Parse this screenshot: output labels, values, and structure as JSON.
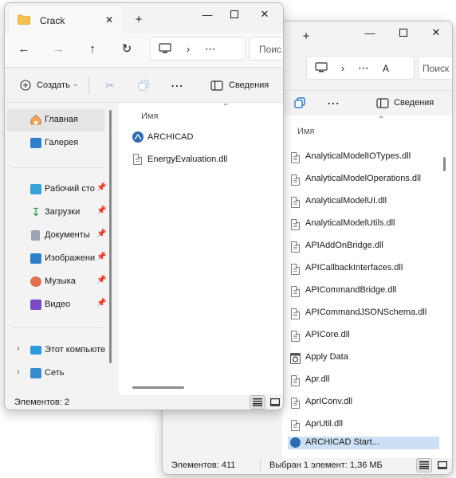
{
  "back_window": {
    "search_placeholder": "Поиск",
    "breadcrumb_more": "⋯",
    "breadcrumb_partial": "A",
    "toolbar": {
      "details_label": "Сведения",
      "more_label": "⋯"
    },
    "column_name": "Имя",
    "files": [
      "AnalyticalModelIOTypes.dll",
      "AnalyticalModelOperations.dll",
      "AnalyticalModelUI.dll",
      "AnalyticalModelUtils.dll",
      "APIAddOnBridge.dll",
      "APICallbackInterfaces.dll",
      "APICommandBridge.dll",
      "APICommandJSONSchema.dll",
      "APICore.dll",
      "Apply Data",
      "Apr.dll",
      "AprIConv.dll",
      "AprUtil.dll",
      "ARCHICAD Start..."
    ],
    "status": {
      "count": "Элементов: 411",
      "selection": "Выбран 1 элемент: 1,36 МБ"
    }
  },
  "front_window": {
    "tab_title": "Crack",
    "new_tab": "+",
    "close_tab": "✕",
    "toolbar": {
      "create_label": "Создать",
      "more_label": "⋯",
      "details_label": "Сведения"
    },
    "breadcrumb_more": "⋯",
    "search_placeholder": "Поис",
    "nav": {
      "home": "Главная",
      "gallery": "Галерея",
      "pinned": [
        "Рабочий сто",
        "Загрузки",
        "Документы",
        "Изображени",
        "Музыка",
        "Видео"
      ],
      "this_pc": "Этот компьюте",
      "network": "Сеть"
    },
    "column_name": "Имя",
    "files": [
      "ARCHICAD",
      "EnergyEvaluation.dll"
    ],
    "status": {
      "count": "Элементов: 2"
    }
  }
}
